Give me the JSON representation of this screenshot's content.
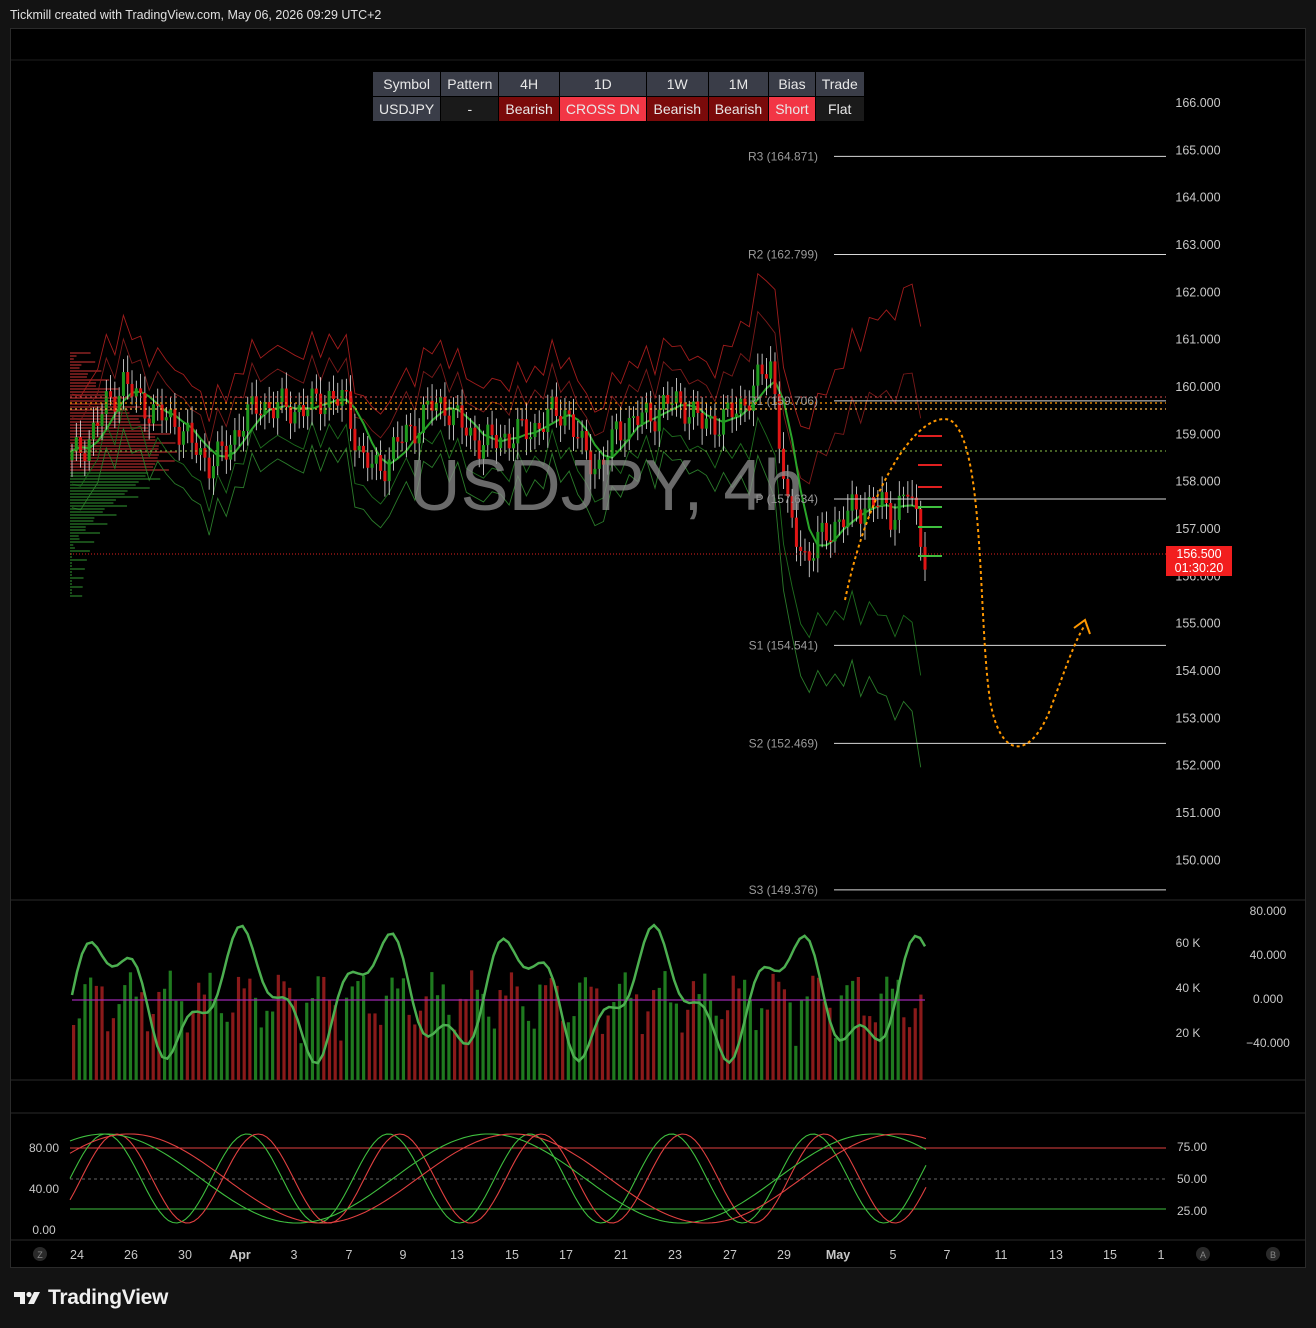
{
  "credit": "Tickmill created with TradingView.com, May 06, 2026 09:29 UTC+2",
  "brand": "TradingView",
  "watermark": "USDJPY, 4h",
  "table": {
    "headers": [
      "Symbol",
      "Pattern",
      "4H",
      "1D",
      "1W",
      "1M",
      "Bias",
      "Trade"
    ],
    "values": [
      "USDJPY",
      "-",
      "Bearish",
      "CROSS DN",
      "Bearish",
      "Bearish",
      "Short",
      "Flat"
    ]
  },
  "price_tag": {
    "price": "156.500",
    "countdown": "01:30:20"
  },
  "colors": {
    "bull": "#1f9a1f",
    "bear": "#e01515",
    "forecast": "#ff9800",
    "rsi_up": "#4caf50",
    "rsi_down": "#ef5350"
  },
  "chart_data": [
    {
      "type": "line",
      "title": "USDJPY, 4h",
      "y_axis_labels": [
        "166.000",
        "165.000",
        "164.000",
        "163.000",
        "162.000",
        "161.000",
        "160.000",
        "159.000",
        "158.000",
        "157.000",
        "156.000",
        "155.000",
        "154.000",
        "153.000",
        "152.000",
        "151.000",
        "150.000"
      ],
      "ylim": [
        149.0,
        166.4
      ],
      "pivots": [
        {
          "name": "R3",
          "label": "R3 (164.871)",
          "value": 164.871
        },
        {
          "name": "R2",
          "label": "R2 (162.799)",
          "value": 162.799
        },
        {
          "name": "R1",
          "label": "R1 (159.706)",
          "value": 159.706
        },
        {
          "name": "P",
          "label": "P (157.634)",
          "value": 157.634
        },
        {
          "name": "S1",
          "label": "S1 (154.541)",
          "value": 154.541
        },
        {
          "name": "S2",
          "label": "S2 (152.469)",
          "value": 152.469
        },
        {
          "name": "S3",
          "label": "S3 (149.376)",
          "value": 149.376
        }
      ],
      "series": [
        {
          "values": [
            158.5,
            158.9,
            159.6,
            160.1,
            159.7,
            159.4,
            159.3,
            158.8,
            158.4,
            158.6,
            159.3,
            159.6,
            159.6,
            159.5,
            159.6,
            159.8,
            159.7,
            158.5,
            158.2,
            158.8,
            159.1,
            159.6,
            159.6,
            159.1,
            158.8,
            158.9,
            159.0,
            159.1,
            159.4,
            159.5,
            158.6,
            158.3,
            159.1,
            159.3,
            159.4,
            159.7,
            159.6,
            159.2,
            159.3,
            159.5,
            160.0,
            160.5,
            157.2,
            156.4,
            156.8,
            157.2,
            157.4,
            157.6,
            157.3,
            157.8,
            156.5
          ]
        }
      ]
    },
    {
      "type": "bar",
      "title": "Volume / RSI panel",
      "y_axis_labels_left": [
        "60 K",
        "40 K",
        "20 K"
      ],
      "y_axis_labels_right": [
        "80.000",
        "40.000",
        "0.000",
        "−40.000"
      ],
      "ylim": [
        -60,
        80
      ]
    },
    {
      "type": "line",
      "title": "Stochastic",
      "y_axis_labels_left": [
        "80.00",
        "40.00",
        "0.00"
      ],
      "y_axis_labels_right": [
        "75.00",
        "50.00",
        "25.00"
      ],
      "ylim": [
        0,
        100
      ]
    }
  ],
  "x_axis": {
    "labels": [
      "24",
      "26",
      "30",
      "Apr",
      "3",
      "7",
      "9",
      "13",
      "15",
      "17",
      "21",
      "23",
      "27",
      "29",
      "May",
      "5",
      "7",
      "11",
      "13",
      "15",
      "1"
    ],
    "corner_buttons": [
      "Z",
      "A",
      "B"
    ]
  }
}
